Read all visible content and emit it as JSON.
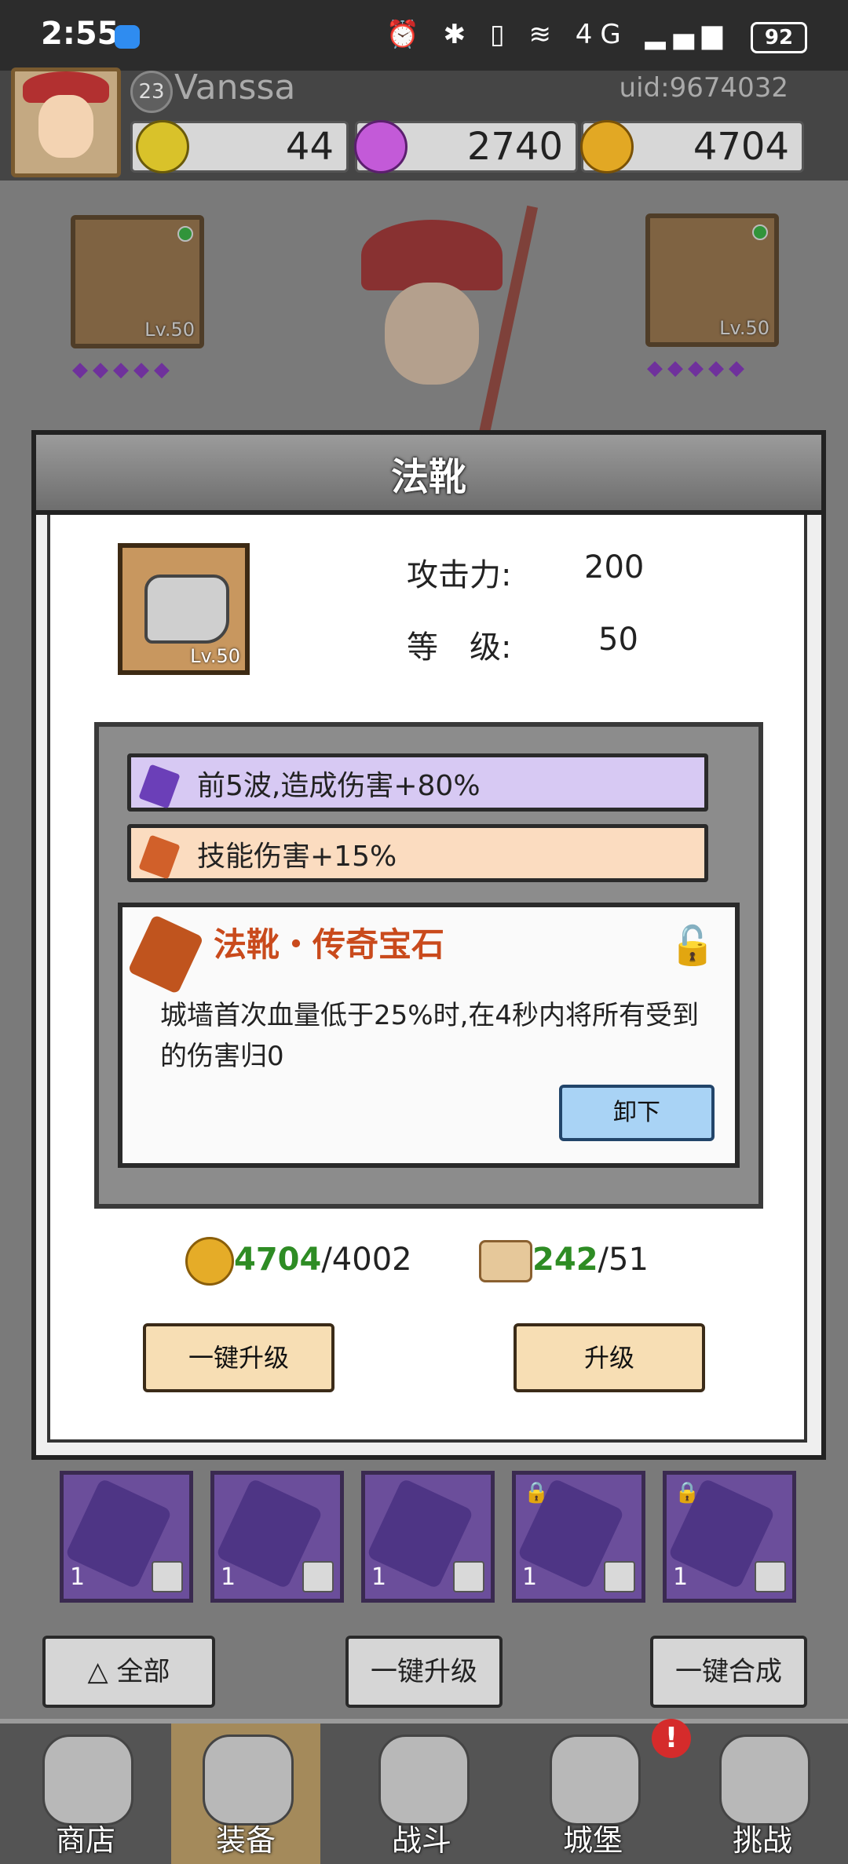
{
  "status_bar": {
    "time": "2:55",
    "battery": "92",
    "icons": "⏰ ✱ ▯ ≋ 4G ▂▄▆"
  },
  "player": {
    "level": "23",
    "name": "Vanssa",
    "uid": "uid:9674032"
  },
  "currencies": {
    "stamina": "44",
    "gems": "2740",
    "gold": "4704"
  },
  "equipment_left": [
    {
      "level": "Lv.50"
    }
  ],
  "equipment_right": [
    {
      "level": "Lv.50"
    }
  ],
  "modal": {
    "title": "法靴",
    "item_level": "Lv.50",
    "attack_label": "攻击力:",
    "attack_value": "200",
    "level_label": "等　级:",
    "level_value": "50",
    "gem_slots": [
      {
        "text": "前5波,造成伤害+80%",
        "color": "#d7c9f3",
        "gem_color": "#6b3fb8"
      },
      {
        "text": "技能伤害+15%",
        "color": "#fbdcc0",
        "gem_color": "#d1602a"
      }
    ],
    "legendary": {
      "title": "法靴・传奇宝石",
      "description": "城墙首次血量低于25%时,在4秒内将所有受到的伤害归0",
      "unequip_label": "卸下"
    },
    "cost": {
      "gold_have": "4704",
      "gold_need": "/4002",
      "scroll_have": "242",
      "scroll_need": "/51"
    },
    "one_key_upgrade_label": "一键升级",
    "upgrade_label": "升级"
  },
  "inventory": [
    {
      "count": "1",
      "locked": false
    },
    {
      "count": "1",
      "locked": false
    },
    {
      "count": "1",
      "locked": false
    },
    {
      "count": "1",
      "locked": true
    },
    {
      "count": "1",
      "locked": true
    }
  ],
  "controls": {
    "filter_label": "全部",
    "filter_icon": "△",
    "upgrade_all_label": "一键升级",
    "merge_all_label": "一键合成"
  },
  "nav": {
    "tabs": [
      "商店",
      "装备",
      "战斗",
      "城堡",
      "挑战"
    ],
    "active": "装备",
    "badge": "!"
  }
}
